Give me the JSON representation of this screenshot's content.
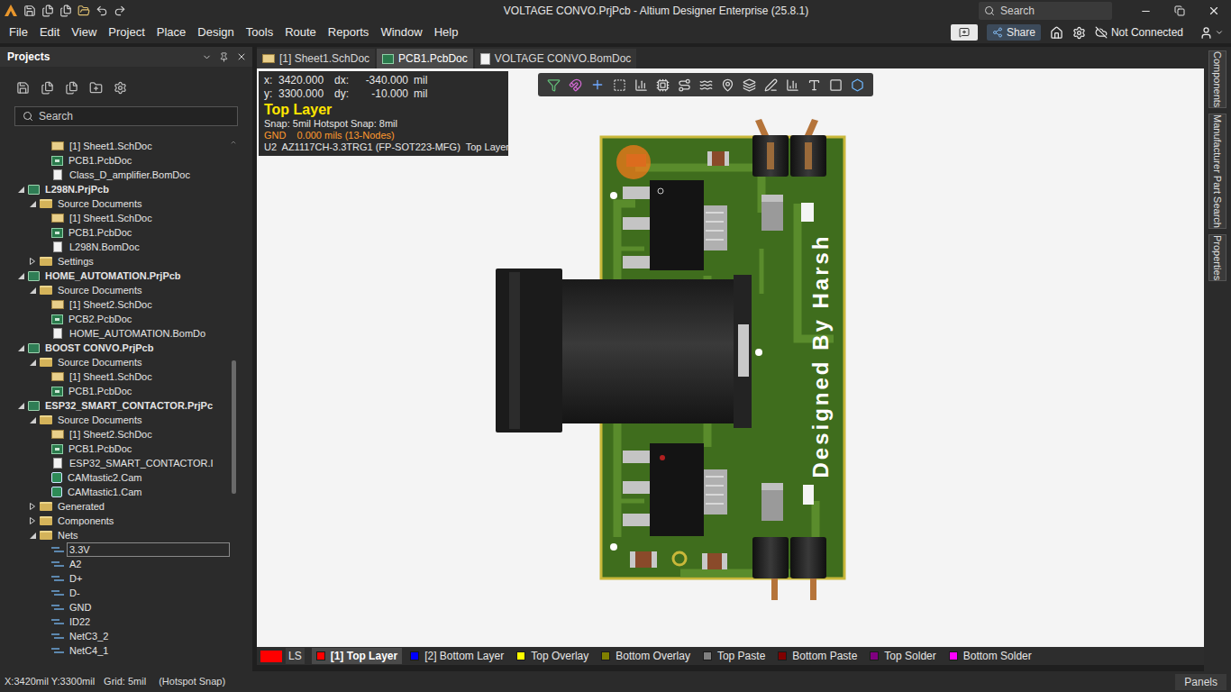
{
  "window": {
    "title": "VOLTAGE CONVO.PrjPcb - Altium Designer Enterprise (25.8.1)",
    "search_placeholder": "Search"
  },
  "menu": [
    "File",
    "Edit",
    "View",
    "Project",
    "Place",
    "Design",
    "Tools",
    "Route",
    "Reports",
    "Window",
    "Help"
  ],
  "menu_right": {
    "share": "Share",
    "connection": "Not Connected"
  },
  "projects_panel": {
    "title": "Projects",
    "search_placeholder": "Search",
    "items": [
      {
        "label": "[1] Sheet1.SchDoc",
        "kind": "schdoc",
        "depth": 3,
        "selected": false
      },
      {
        "label": "PCB1.PcbDoc",
        "kind": "pcbdoc",
        "depth": 3,
        "selected": false
      },
      {
        "label": "Class_D_amplifier.BomDoc",
        "kind": "bomdoc",
        "depth": 3,
        "selected": false
      },
      {
        "label": "L298N.PrjPcb",
        "kind": "project",
        "depth": 1,
        "expanded": true,
        "selected": false
      },
      {
        "label": "Source Documents",
        "kind": "folder",
        "depth": 2,
        "expanded": true,
        "selected": false
      },
      {
        "label": "[1] Sheet1.SchDoc",
        "kind": "schdoc",
        "depth": 3,
        "selected": false
      },
      {
        "label": "PCB1.PcbDoc",
        "kind": "pcbdoc",
        "depth": 3,
        "selected": false
      },
      {
        "label": "L298N.BomDoc",
        "kind": "bomdoc",
        "depth": 3,
        "selected": false
      },
      {
        "label": "Settings",
        "kind": "folder",
        "depth": 2,
        "expanded": false,
        "selected": false
      },
      {
        "label": "HOME_AUTOMATION.PrjPcb",
        "kind": "project",
        "depth": 1,
        "expanded": true,
        "selected": false
      },
      {
        "label": "Source Documents",
        "kind": "folder",
        "depth": 2,
        "expanded": true,
        "selected": false
      },
      {
        "label": "[1] Sheet2.SchDoc",
        "kind": "schdoc",
        "depth": 3,
        "selected": false
      },
      {
        "label": "PCB2.PcbDoc",
        "kind": "pcbdoc",
        "depth": 3,
        "selected": false
      },
      {
        "label": "HOME_AUTOMATION.BomDo",
        "kind": "bomdoc",
        "depth": 3,
        "selected": false
      },
      {
        "label": "BOOST CONVO.PrjPcb",
        "kind": "project",
        "depth": 1,
        "expanded": true,
        "selected": false
      },
      {
        "label": "Source Documents",
        "kind": "folder",
        "depth": 2,
        "expanded": true,
        "selected": false
      },
      {
        "label": "[1] Sheet1.SchDoc",
        "kind": "schdoc",
        "depth": 3,
        "selected": false
      },
      {
        "label": "PCB1.PcbDoc",
        "kind": "pcbdoc",
        "depth": 3,
        "selected": false
      },
      {
        "label": "ESP32_SMART_CONTACTOR.PrjPc",
        "kind": "project",
        "depth": 1,
        "expanded": true,
        "selected": false
      },
      {
        "label": "Source Documents",
        "kind": "folder",
        "depth": 2,
        "expanded": true,
        "selected": false
      },
      {
        "label": "[1] Sheet2.SchDoc",
        "kind": "schdoc",
        "depth": 3,
        "selected": false
      },
      {
        "label": "PCB1.PcbDoc",
        "kind": "pcbdoc",
        "depth": 3,
        "selected": false
      },
      {
        "label": "ESP32_SMART_CONTACTOR.I",
        "kind": "bomdoc",
        "depth": 3,
        "selected": false
      },
      {
        "label": "CAMtastic2.Cam",
        "kind": "cam",
        "depth": 3,
        "selected": false
      },
      {
        "label": "CAMtastic1.Cam",
        "kind": "cam",
        "depth": 3,
        "selected": false
      },
      {
        "label": "Generated",
        "kind": "folder",
        "depth": 2,
        "expanded": false,
        "selected": false
      },
      {
        "label": "Components",
        "kind": "folder",
        "depth": 2,
        "expanded": false,
        "selected": false
      },
      {
        "label": "Nets",
        "kind": "folder",
        "depth": 2,
        "expanded": true,
        "selected": false
      },
      {
        "label": "3.3V",
        "kind": "net",
        "depth": 3,
        "selected": true
      },
      {
        "label": "A2",
        "kind": "net",
        "depth": 3,
        "selected": false
      },
      {
        "label": "D+",
        "kind": "net",
        "depth": 3,
        "selected": false
      },
      {
        "label": "D-",
        "kind": "net",
        "depth": 3,
        "selected": false
      },
      {
        "label": "GND",
        "kind": "net",
        "depth": 3,
        "selected": false
      },
      {
        "label": "ID22",
        "kind": "net",
        "depth": 3,
        "selected": false
      },
      {
        "label": "NetC3_2",
        "kind": "net",
        "depth": 3,
        "selected": false
      },
      {
        "label": "NetC4_1",
        "kind": "net",
        "depth": 3,
        "selected": false
      }
    ]
  },
  "doc_tabs": [
    {
      "label": "[1] Sheet1.SchDoc",
      "kind": "schdoc",
      "selected": false
    },
    {
      "label": "PCB1.PcbDoc",
      "kind": "pcbdoc",
      "selected": true
    },
    {
      "label": "VOLTAGE CONVO.BomDoc",
      "kind": "bomdoc",
      "selected": false
    }
  ],
  "right_tabs": [
    "Components",
    "Manufacturer Part Search",
    "Properties"
  ],
  "hud": {
    "coords": [
      {
        "label": "x:",
        "value": "3420.000",
        "delta_label": "dx:",
        "delta": "-340.000",
        "unit": "mil"
      },
      {
        "label": "y:",
        "value": "3300.000",
        "delta_label": "dy:",
        "delta": "-10.000",
        "unit": "mil"
      }
    ],
    "layer": "Top Layer",
    "snap": "Snap: 5mil Hotspot Snap: 8mil",
    "net": "GND",
    "net_info": "0.000 mils (13-Nodes)",
    "component": "U2  AZ1117CH-3.3TRG1 (FP-SOT223-MFG)  Top Layer"
  },
  "pcb": {
    "silkscreen": "Designed By Harsh"
  },
  "layer_tabs": {
    "set": "LS",
    "layers": [
      {
        "label": "[1] Top Layer",
        "color": "#ff0000",
        "selected": true
      },
      {
        "label": "[2] Bottom Layer",
        "color": "#0000ff",
        "selected": false
      },
      {
        "label": "Top Overlay",
        "color": "#ffff00",
        "selected": false
      },
      {
        "label": "Bottom Overlay",
        "color": "#808000",
        "selected": false
      },
      {
        "label": "Top Paste",
        "color": "#808080",
        "selected": false
      },
      {
        "label": "Bottom Paste",
        "color": "#800000",
        "selected": false
      },
      {
        "label": "Top Solder",
        "color": "#800080",
        "selected": false
      },
      {
        "label": "Bottom Solder",
        "color": "#ff00ff",
        "selected": false
      }
    ]
  },
  "status_bar": {
    "position": "X:3420mil Y:3300mil",
    "grid": "Grid: 5mil",
    "snap": "(Hotspot Snap)",
    "panels": "Panels"
  }
}
